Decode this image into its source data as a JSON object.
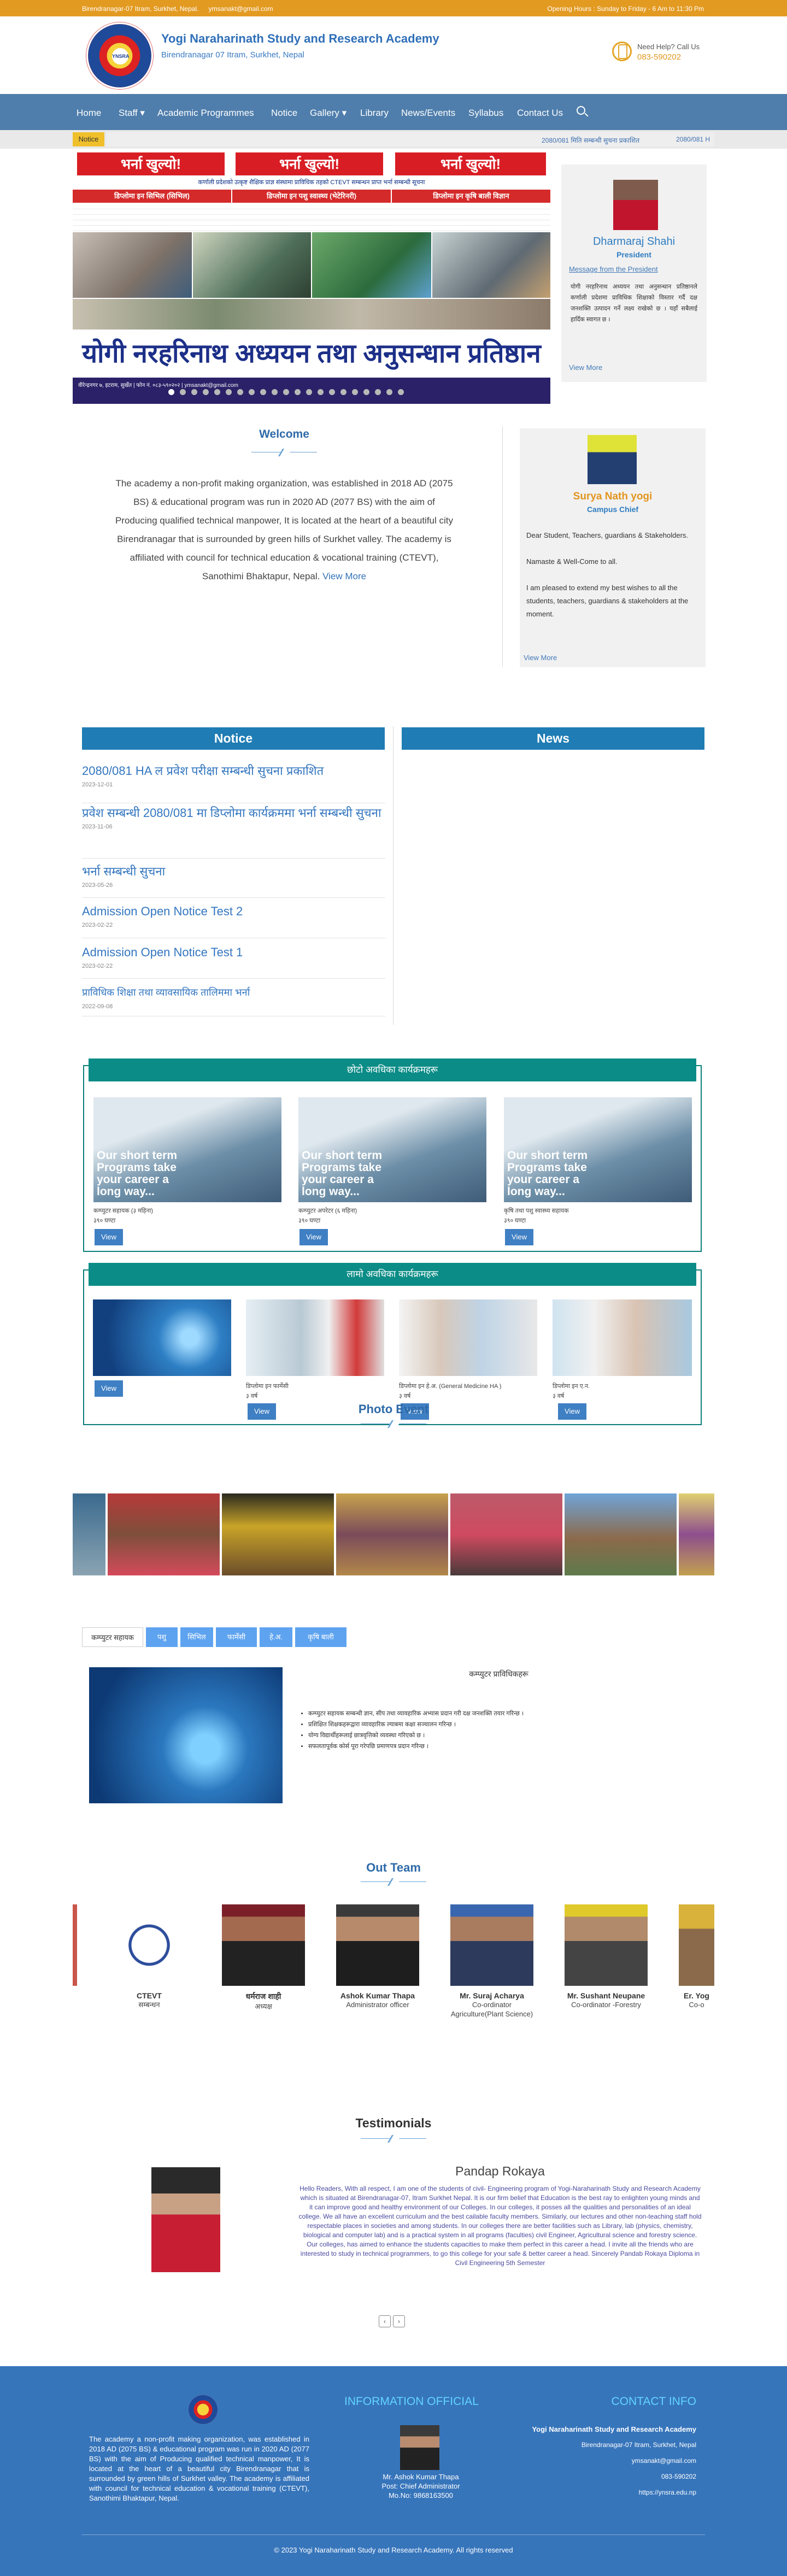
{
  "topbar": {
    "address": "Birendranagar-07 Itram, Surkhet, Nepal.",
    "email": "ymsanakt@gmail.com",
    "hours": "Opening Hours : Sunday to Friday - 6 Am to 11:30 Pm"
  },
  "header": {
    "title": "Yogi Naraharinath Study and Research Academy",
    "subtitle": "Birendranagar 07 Itram, Surkhet, Nepal",
    "help_label": "Need Help? Call Us",
    "help_phone": "083-590202",
    "logo_text": "YNSRA"
  },
  "nav": {
    "items": [
      {
        "label": "Home"
      },
      {
        "label": "Staff ▾"
      },
      {
        "label": "Academic Programmes"
      },
      {
        "label": "Notice"
      },
      {
        "label": "Gallery ▾"
      },
      {
        "label": "Library"
      },
      {
        "label": "News/Events"
      },
      {
        "label": "Syllabus"
      },
      {
        "label": "Contact Us"
      }
    ]
  },
  "ticker": {
    "label": "Notice",
    "item1": "2080/081 मिति सम्बन्धी सुचना प्रकाशित",
    "item2": "2080/081 H"
  },
  "banner": {
    "headline": "भर्ना खुल्यो!",
    "subline": "कर्णाली प्रदेशको उत्कृष्ट शैक्षिक प्राज्ञ संस्थामा प्राविधिक तहको CTEVT सम्बन्धन प्राप्त भर्ना सम्बन्धी सूचना",
    "dip1": "डिप्लोमा इन सिभिल (सिभिल)",
    "dip2": "डिप्लोमा इन पशु स्वास्थ्य (भेटेरिनरी)",
    "dip3": "डिप्लोमा इन कृषि बाली विज्ञान",
    "title": "योगी नरहरिनाथ अध्ययन तथा अनुसन्धान प्रतिष्ठान",
    "footer": "वीरेन्द्रनगर ७, इटराम, सुर्खेत | फोन नं. ०८३-५९०२०२ | ymsanakt@gmail.com"
  },
  "president": {
    "name": "Dharmaraj Shahi",
    "role": "President",
    "link": "Message from the President",
    "message": "योगी नरहरिनाथ अध्ययन तथा अनुसन्धान प्रतिष्ठानले कर्णाली प्रदेशमा प्राविधिक शिक्षाको विस्तार गर्दै दक्ष जनशक्ति उत्पादन गर्ने लक्ष्य राखेको छ । यहाँ सबैलाई हार्दिक स्वागत छ ।",
    "more": "View More"
  },
  "welcome": {
    "heading": "Welcome",
    "text": "The academy a non-profit making organization, was established in 2018 AD (2075 BS) & educational program was run in 2020 AD (2077 BS) with the aim of Producing qualified technical manpower, It is located at the heart of a beautiful city Birendranagar that is surrounded by green hills of Surkhet valley. The academy is affiliated with council for technical education & vocational training (CTEVT), Sanothimi Bhaktapur, Nepal.",
    "more": "View More"
  },
  "chief": {
    "name": "Surya Nath yogi",
    "role": "Campus Chief",
    "greet": "Dear Student, Teachers, guardians & Stakeholders.",
    "namaste": "Namaste & Well-Come to all.",
    "msg": "I am pleased to extend my best wishes to all the students, teachers, guardians & stakeholders at the moment.",
    "more": "View More"
  },
  "notices": {
    "heading": "Notice",
    "items": [
      {
        "title": "2080/081 HA ल प्रवेश परीक्षा सम्बन्धी सुचना प्रकाशित",
        "date": "2023-12-01"
      },
      {
        "title": "प्रवेश सम्बन्धी 2080/081 मा डिप्लोमा कार्यक्रममा भर्ना सम्बन्धी सुचना",
        "date": "2023-11-06"
      },
      {
        "title": "भर्ना सम्बन्धी सुचना",
        "date": "2023-05-26"
      },
      {
        "title": "Admission Open Notice Test 2",
        "date": "2023-02-22"
      },
      {
        "title": "Admission Open Notice Test 1",
        "date": "2023-02-22"
      },
      {
        "title": "प्राविधिक शिक्षा तथा व्यावसायिक तालिममा भर्ना",
        "date": "2022-09-08"
      }
    ]
  },
  "news": {
    "heading": "News"
  },
  "short_programs": {
    "heading": "छोटो अवधिका कार्यक्रमहरू",
    "caption": "Our short term Programs take your career a long way...",
    "view": "View",
    "items": [
      {
        "title": "कम्प्युटर सहायक (३ महिना)",
        "sub": "३९० घण्टा"
      },
      {
        "title": "कम्प्युटर अपरेटर (६ महिना)",
        "sub": "३९० घण्टा"
      },
      {
        "title": "कृषि तथा पशु स्वास्थ्य सहायक",
        "sub": "३९० घण्टा"
      }
    ]
  },
  "long_programs": {
    "heading": "लामो अवधिका कार्यक्रमहरू",
    "view": "View",
    "items": [
      {
        "title": "",
        "sub": ""
      },
      {
        "title": "डिप्लोमा इन फार्मेसी",
        "sub": "३ वर्ष"
      },
      {
        "title": "डिप्लोमा इन हे.अ. (General Medicine HA )",
        "sub": "३ वर्ष"
      },
      {
        "title": "डिप्लोमा इन ए.न.",
        "sub": "३ वर्ष"
      }
    ]
  },
  "photo_event": {
    "heading": "Photo Event"
  },
  "program_tabs": {
    "tabs": [
      "कम्प्युटर सहायक",
      "पशु",
      "सिभिल",
      "फार्मेसी",
      "हे.अ.",
      "कृषि बाली"
    ],
    "title": "कम्प्युटर प्राविधिकहरू",
    "bullets": [
      "कम्प्युटर सहायक सम्बन्धी ज्ञान, सीप तथा व्यावहारिक अभ्यास प्रदान गरी दक्ष जनशक्ति तयार गरिन्छ ।",
      "प्रशिक्षित शिक्षकहरूद्वारा व्यावहारिक ल्याबमा कक्षा सञ्चालन गरिन्छ ।",
      "योग्य विद्यार्थीहरूलाई छात्रवृत्तिको व्यवस्था गरिएको छ ।",
      "सफलतापूर्वक कोर्स पूरा गरेपछि प्रमाणपत्र प्रदान गरिन्छ ।"
    ]
  },
  "team": {
    "heading": "Out Team",
    "members": [
      {
        "name": "CTEVT",
        "role": "सम्बन्धन"
      },
      {
        "name": "धर्मराज शाही",
        "role": "अध्यक्ष"
      },
      {
        "name": "Ashok Kumar Thapa",
        "role": "Administrator officer"
      },
      {
        "name": "Mr. Suraj Acharya",
        "role": "Co-ordinator Agriculture(Plant Science)"
      },
      {
        "name": "Mr. Sushant Neupane",
        "role": "Co-ordinator -Forestry"
      },
      {
        "name": "Er. Yog",
        "role": "Co-o"
      }
    ]
  },
  "testimonials": {
    "heading": "Testimonials",
    "name": "Pandap Rokaya",
    "text": "Hello Readers, With all respect, I am one of the students of civil- Engineering program of Yogi-Naraharinath Study and Research Academy which is situated at Birendranagar-07, Itram Surkhet Nepal. It is our firm belief that Education is the best ray to enlighten young minds and it can improve good and healthy environment of our Colleges. In our colleges, it posses all the qualities and personalities of an ideal college. We all have an excellent curriculum and the best cailable faculty members. Similarly, our lectures and other non-teaching staff hold respectable places in societies and among students. In our colleges there are better facilities such as Library, lab (physics, chemistry, biological and computer lab) and is a practical system in all programs (faculties) civil Engineer, Agricultural science and forestry science. Our colleges, has aimed to enhance the students capacities to make them perfect in this career a head. I invite all the friends who are interested to study in technical programmers, to go this college for your safe & better career a head. Sincerely Pandab Rokaya Diploma in Civil Engineering 5th Semester",
    "prev": "‹",
    "next": "›"
  },
  "footer": {
    "about": "The academy a non-profit making organization, was established in 2018 AD (2075 BS) & educational program was run in 2020 AD (2077 BS) with the aim of Producing qualified technical manpower, It is located at the heart of a beautiful city Birendranagar that is surrounded by green hills of Surkhet valley. The academy is affiliated with council for technical education & vocational training (CTEVT), Sanothimi Bhaktapur, Nepal.",
    "official_heading": "INFORMATION OFFICIAL",
    "official_name": "Mr. Ashok Kumar Thapa",
    "official_role": "Post: Chief Administrator",
    "official_mobile": "Mo.No: 9868163500",
    "contact_heading": "CONTACT INFO",
    "org": "Yogi Naraharinath Study and Research Academy",
    "address": "Birendranagar-07 Itram, Surkhet, Nepal",
    "email": "ymsanakt@gmail.com",
    "phone": "083-590202",
    "web": "https://ynsra.edu.np",
    "copyright": "© 2023 Yogi Naraharinath Study and Research Academy. All rights reserved"
  }
}
